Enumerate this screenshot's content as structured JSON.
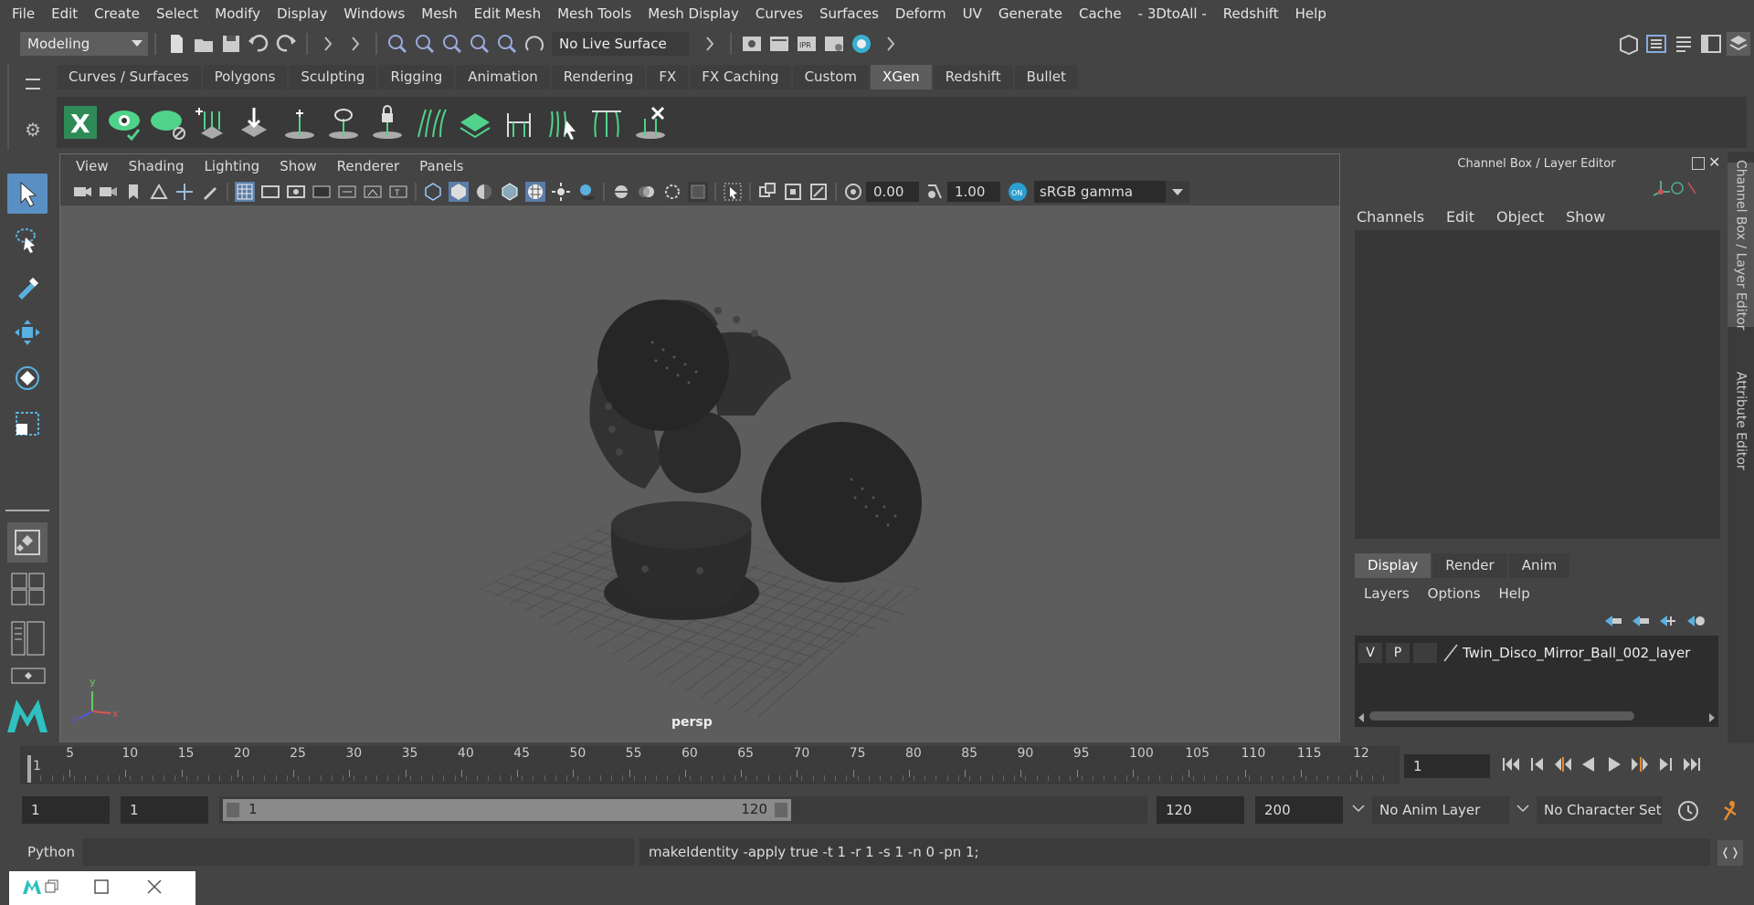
{
  "menubar": {
    "items": [
      "File",
      "Edit",
      "Create",
      "Select",
      "Modify",
      "Display",
      "Windows",
      "Mesh",
      "Edit Mesh",
      "Mesh Tools",
      "Mesh Display",
      "Curves",
      "Surfaces",
      "Deform",
      "UV",
      "Generate",
      "Cache",
      "- 3DtoAll -",
      "Redshift",
      "Help"
    ]
  },
  "status_line": {
    "workspace": "Modeling",
    "live_surface": "No Live Surface"
  },
  "shelf": {
    "tabs": [
      "Curves / Surfaces",
      "Polygons",
      "Sculpting",
      "Rigging",
      "Animation",
      "Rendering",
      "FX",
      "FX Caching",
      "Custom",
      "XGen",
      "Redshift",
      "Bullet"
    ],
    "active_tab": "XGen",
    "icons": [
      "xgen-x-icon",
      "xgen-preview-icon",
      "xgen-leaf-icon",
      "xgen-add-guide-icon",
      "xgen-sculpt-guide-icon",
      "xgen-guide-icon",
      "xgen-visibility-icon",
      "xgen-lock-icon",
      "xgen-comb-icon",
      "xgen-layer-icon",
      "xgen-cut-icon",
      "xgen-grab-icon",
      "xgen-length-icon",
      "xgen-delete-icon"
    ]
  },
  "viewport": {
    "menu": [
      "View",
      "Shading",
      "Lighting",
      "Show",
      "Renderer",
      "Panels"
    ],
    "exposure": "0.00",
    "gamma": "1.00",
    "color_space": "sRGB gamma",
    "camera_label": "persp",
    "axis_labels": {
      "x": "x",
      "y": "y",
      "z": "z"
    }
  },
  "channel_box": {
    "title": "Channel Box / Layer Editor",
    "menu": [
      "Channels",
      "Edit",
      "Object",
      "Show"
    ],
    "layer_tabs": [
      "Display",
      "Render",
      "Anim"
    ],
    "active_layer_tab": "Display",
    "layer_menu": [
      "Layers",
      "Options",
      "Help"
    ],
    "layer": {
      "v": "V",
      "p": "P",
      "name": "Twin_Disco_Mirror_Ball_002_layer"
    }
  },
  "side_tabs": [
    "Channel Box / Layer Editor",
    "Attribute Editor"
  ],
  "time_slider": {
    "ticks": [
      "1",
      "5",
      "10",
      "15",
      "20",
      "25",
      "30",
      "35",
      "40",
      "45",
      "50",
      "55",
      "60",
      "65",
      "70",
      "75",
      "80",
      "85",
      "90",
      "95",
      "100",
      "105",
      "110",
      "115",
      "12"
    ],
    "current_frame": "1"
  },
  "range": {
    "start": "1",
    "anim_start": "1",
    "range_start": "1",
    "range_end": "120",
    "anim_end": "120",
    "end": "200",
    "anim_layer": "No Anim Layer",
    "character_set": "No Character Set"
  },
  "command_line": {
    "language": "Python",
    "result": "makeIdentity -apply true -t 1 -r 1 -s 1 -n 0 -pn 1;"
  },
  "colors": {
    "accent": "#5d5d5d",
    "shelf_icon": "#4fd38a",
    "selection_blue": "#5a8fc4"
  }
}
